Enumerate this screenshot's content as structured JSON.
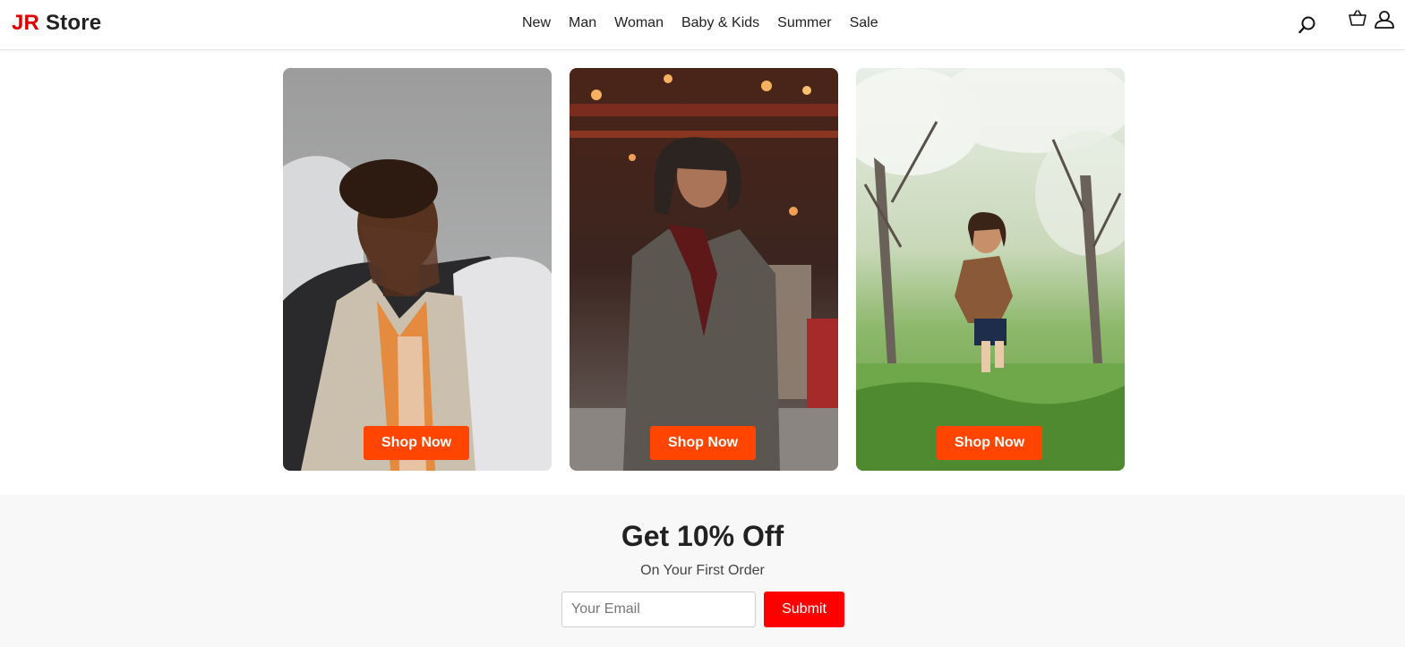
{
  "header": {
    "logo_prefix": "JR",
    "logo_suffix": "Store",
    "nav": [
      "New",
      "Man",
      "Woman",
      "Baby & Kids",
      "Summer",
      "Sale"
    ],
    "icons": [
      "search-icon",
      "cart-icon",
      "user-icon"
    ]
  },
  "cards": [
    {
      "button": "Shop Now",
      "subject": "man"
    },
    {
      "button": "Shop Now",
      "subject": "woman"
    },
    {
      "button": "Shop Now",
      "subject": "kid"
    }
  ],
  "promo": {
    "title": "Get 10% Off",
    "subtitle": "On Your First Order",
    "email_placeholder": "Your Email",
    "submit_label": "Submit"
  },
  "colors": {
    "accent": "#ff4500",
    "logo_red": "#e00000",
    "submit_red": "#ff0000"
  }
}
